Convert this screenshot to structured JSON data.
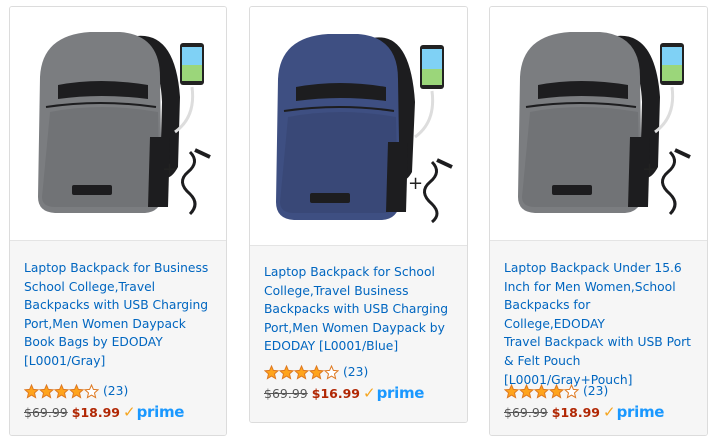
{
  "products": [
    {
      "title_lines": [
        "Laptop Backpack for Business",
        "School College,Travel",
        "Backpacks with USB Charging",
        "Port,Men Women Daypack",
        "Book Bags by EDODAY",
        "[L0001/Gray]"
      ],
      "rating": 4,
      "review_count": "(23)",
      "list_price": "$69.99",
      "sale_price": "$18.99",
      "prime_label": "prime",
      "color": "#7b7d80"
    },
    {
      "title_lines": [
        "Laptop Backpack for School",
        "College,Travel Business",
        "Backpacks with USB Charging",
        "Port,Men Women Daypack by",
        "EDODAY [L0001/Blue]"
      ],
      "rating": 4,
      "review_count": "(23)",
      "list_price": "$69.99",
      "sale_price": "$16.99",
      "prime_label": "prime",
      "color": "#3e4f82"
    },
    {
      "title_lines": [
        "Laptop Backpack Under 15.6",
        "Inch for Men Women,School",
        "Backpacks for College,EDODAY",
        "Travel Backpack with USB Port",
        "& Felt Pouch",
        "[L0001/Gray+Pouch]"
      ],
      "rating": 4,
      "review_count": "(23)",
      "list_price": "$69.99",
      "sale_price": "$18.99",
      "prime_label": "prime",
      "color": "#7b7d80"
    }
  ]
}
